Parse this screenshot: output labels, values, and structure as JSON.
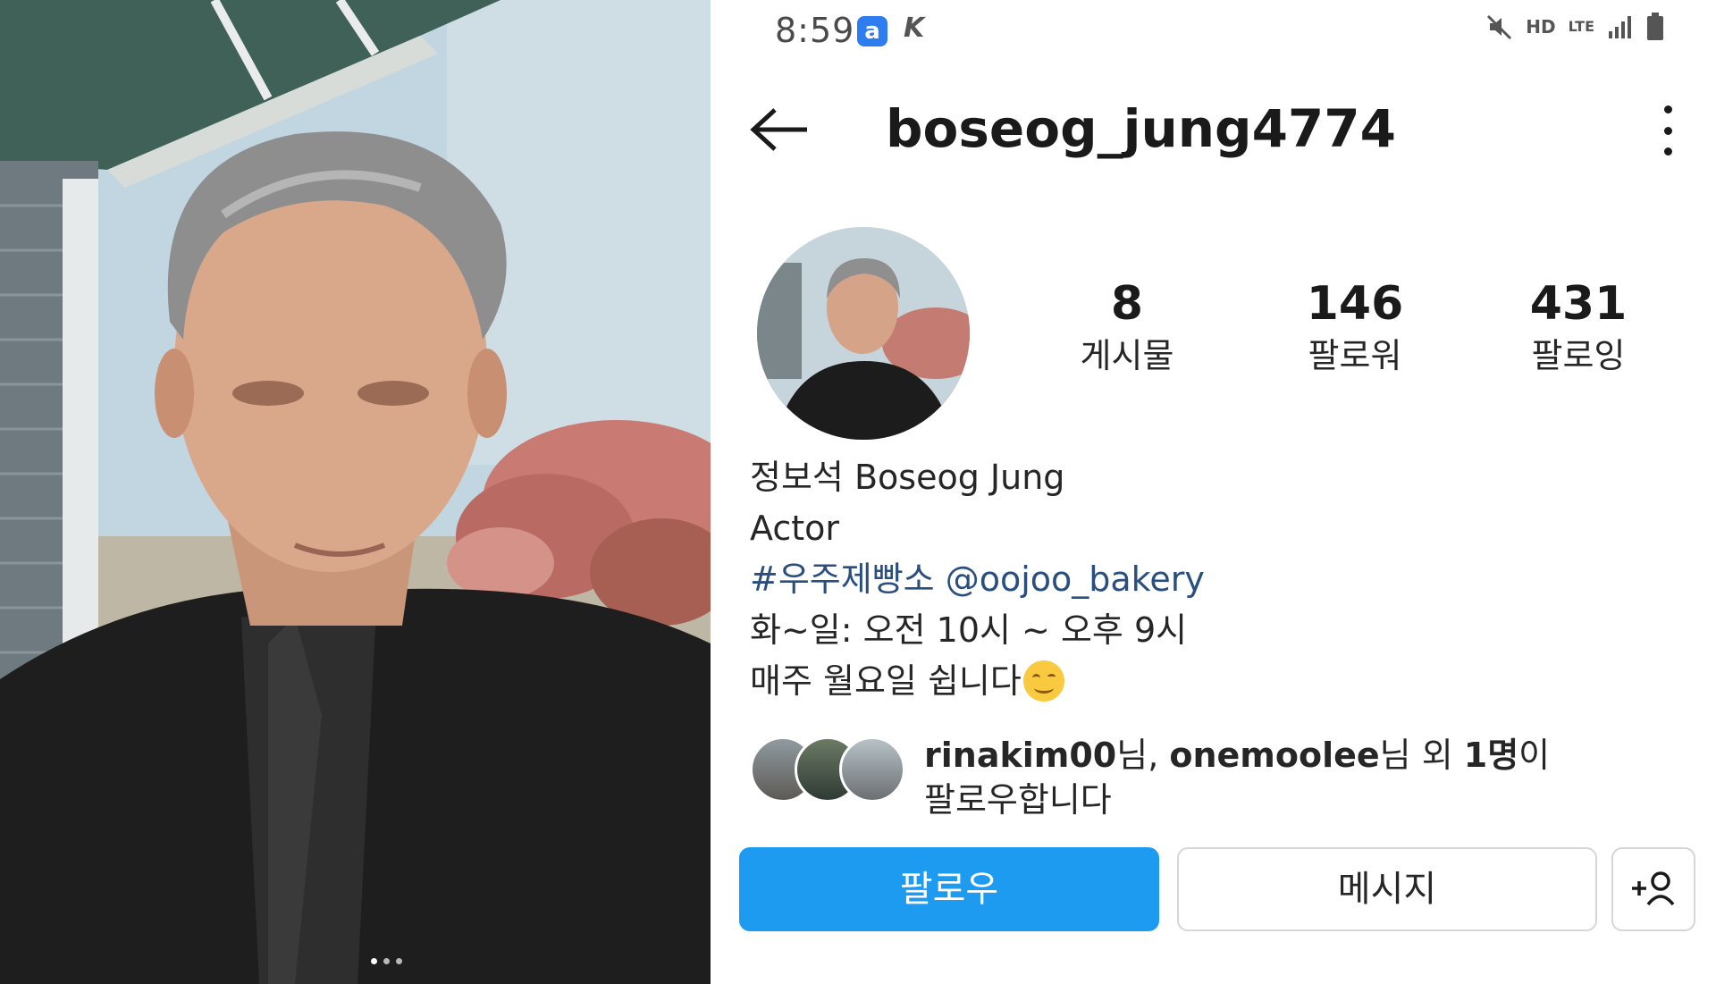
{
  "status_bar": {
    "time": "8:59",
    "app_badge_a": "a",
    "app_badge_k": "K",
    "hd": "HD",
    "lte": "LTE"
  },
  "header": {
    "username": "boseog_jung4774",
    "back_icon": "arrow-left-icon",
    "menu_icon": "more-vertical-icon"
  },
  "stats": [
    {
      "value": "8",
      "label": "게시물"
    },
    {
      "value": "146",
      "label": "팔로워"
    },
    {
      "value": "431",
      "label": "팔로잉"
    }
  ],
  "bio": {
    "name": "정보석 Boseog Jung",
    "category": "Actor",
    "links": "#우주제빵소 @oojoo_bakery",
    "hours": "화~일: 오전 10시 ~ 오후 9시",
    "closed": "매주 월요일 쉽니다"
  },
  "followed_by": {
    "user1": "rinakim00",
    "suffix1": "님, ",
    "user2": "onemoolee",
    "suffix2": "님 외 ",
    "count": "1명",
    "suffix3": "이",
    "line2": "팔로우합니다"
  },
  "actions": {
    "follow": "팔로우",
    "message": "메시지",
    "suggest_icon": "add-person-icon"
  },
  "carousel": {
    "count": 3,
    "active": 1
  },
  "colors": {
    "follow_button": "#1d9bf0",
    "link_text": "#2a4f7f"
  }
}
